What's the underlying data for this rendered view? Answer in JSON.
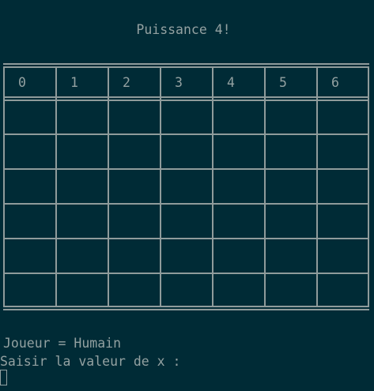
{
  "game": {
    "title": "Puissance 4!",
    "columns": [
      "0",
      "1",
      "2",
      "3",
      "4",
      "5",
      "6"
    ],
    "rows": 6
  },
  "status": {
    "player": "Joueur = Humain",
    "prompt": "Saisir la valeur de x :"
  },
  "colors": {
    "background": "#002b36",
    "text": "#93a1a1",
    "grid": "#8f9b9b"
  }
}
